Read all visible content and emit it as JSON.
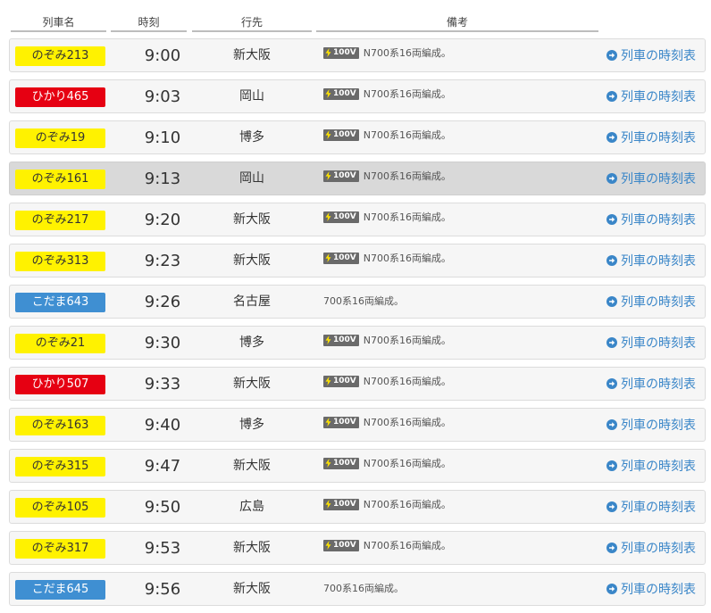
{
  "header": {
    "col_train": "列車名",
    "col_time": "時刻",
    "col_dest": "行先",
    "col_note": "備考"
  },
  "rows": [
    {
      "train": "のぞみ213",
      "type": "nozomi",
      "time": "9:00",
      "dest": "新大阪",
      "badge": "100V",
      "note": "N700系16両編成。",
      "link": "列車の時刻表",
      "highlight": false
    },
    {
      "train": "ひかり465",
      "type": "hikari",
      "time": "9:03",
      "dest": "岡山",
      "badge": "100V",
      "note": "N700系16両編成。",
      "link": "列車の時刻表",
      "highlight": false
    },
    {
      "train": "のぞみ19",
      "type": "nozomi",
      "time": "9:10",
      "dest": "博多",
      "badge": "100V",
      "note": "N700系16両編成。",
      "link": "列車の時刻表",
      "highlight": false
    },
    {
      "train": "のぞみ161",
      "type": "nozomi",
      "time": "9:13",
      "dest": "岡山",
      "badge": "100V",
      "note": "N700系16両編成。",
      "link": "列車の時刻表",
      "highlight": true
    },
    {
      "train": "のぞみ217",
      "type": "nozomi",
      "time": "9:20",
      "dest": "新大阪",
      "badge": "100V",
      "note": "N700系16両編成。",
      "link": "列車の時刻表",
      "highlight": false
    },
    {
      "train": "のぞみ313",
      "type": "nozomi",
      "time": "9:23",
      "dest": "新大阪",
      "badge": "100V",
      "note": "N700系16両編成。",
      "link": "列車の時刻表",
      "highlight": false
    },
    {
      "train": "こだま643",
      "type": "kodama",
      "time": "9:26",
      "dest": "名古屋",
      "badge": "",
      "note": "700系16両編成。",
      "link": "列車の時刻表",
      "highlight": false
    },
    {
      "train": "のぞみ21",
      "type": "nozomi",
      "time": "9:30",
      "dest": "博多",
      "badge": "100V",
      "note": "N700系16両編成。",
      "link": "列車の時刻表",
      "highlight": false
    },
    {
      "train": "ひかり507",
      "type": "hikari",
      "time": "9:33",
      "dest": "新大阪",
      "badge": "100V",
      "note": "N700系16両編成。",
      "link": "列車の時刻表",
      "highlight": false
    },
    {
      "train": "のぞみ163",
      "type": "nozomi",
      "time": "9:40",
      "dest": "博多",
      "badge": "100V",
      "note": "N700系16両編成。",
      "link": "列車の時刻表",
      "highlight": false
    },
    {
      "train": "のぞみ315",
      "type": "nozomi",
      "time": "9:47",
      "dest": "新大阪",
      "badge": "100V",
      "note": "N700系16両編成。",
      "link": "列車の時刻表",
      "highlight": false
    },
    {
      "train": "のぞみ105",
      "type": "nozomi",
      "time": "9:50",
      "dest": "広島",
      "badge": "100V",
      "note": "N700系16両編成。",
      "link": "列車の時刻表",
      "highlight": false
    },
    {
      "train": "のぞみ317",
      "type": "nozomi",
      "time": "9:53",
      "dest": "新大阪",
      "badge": "100V",
      "note": "N700系16両編成。",
      "link": "列車の時刻表",
      "highlight": false
    },
    {
      "train": "こだま645",
      "type": "kodama",
      "time": "9:56",
      "dest": "新大阪",
      "badge": "",
      "note": "700系16両編成。",
      "link": "列車の時刻表",
      "highlight": false
    }
  ],
  "colors": {
    "nozomi": "#fff200",
    "hikari": "#e60012",
    "kodama": "#3f8fd2",
    "link": "#3a86c8",
    "highlight_row": "#d9d9d9"
  },
  "icons": {
    "power": "lightning-bolt-icon",
    "link": "circle-arrow-right-icon"
  }
}
